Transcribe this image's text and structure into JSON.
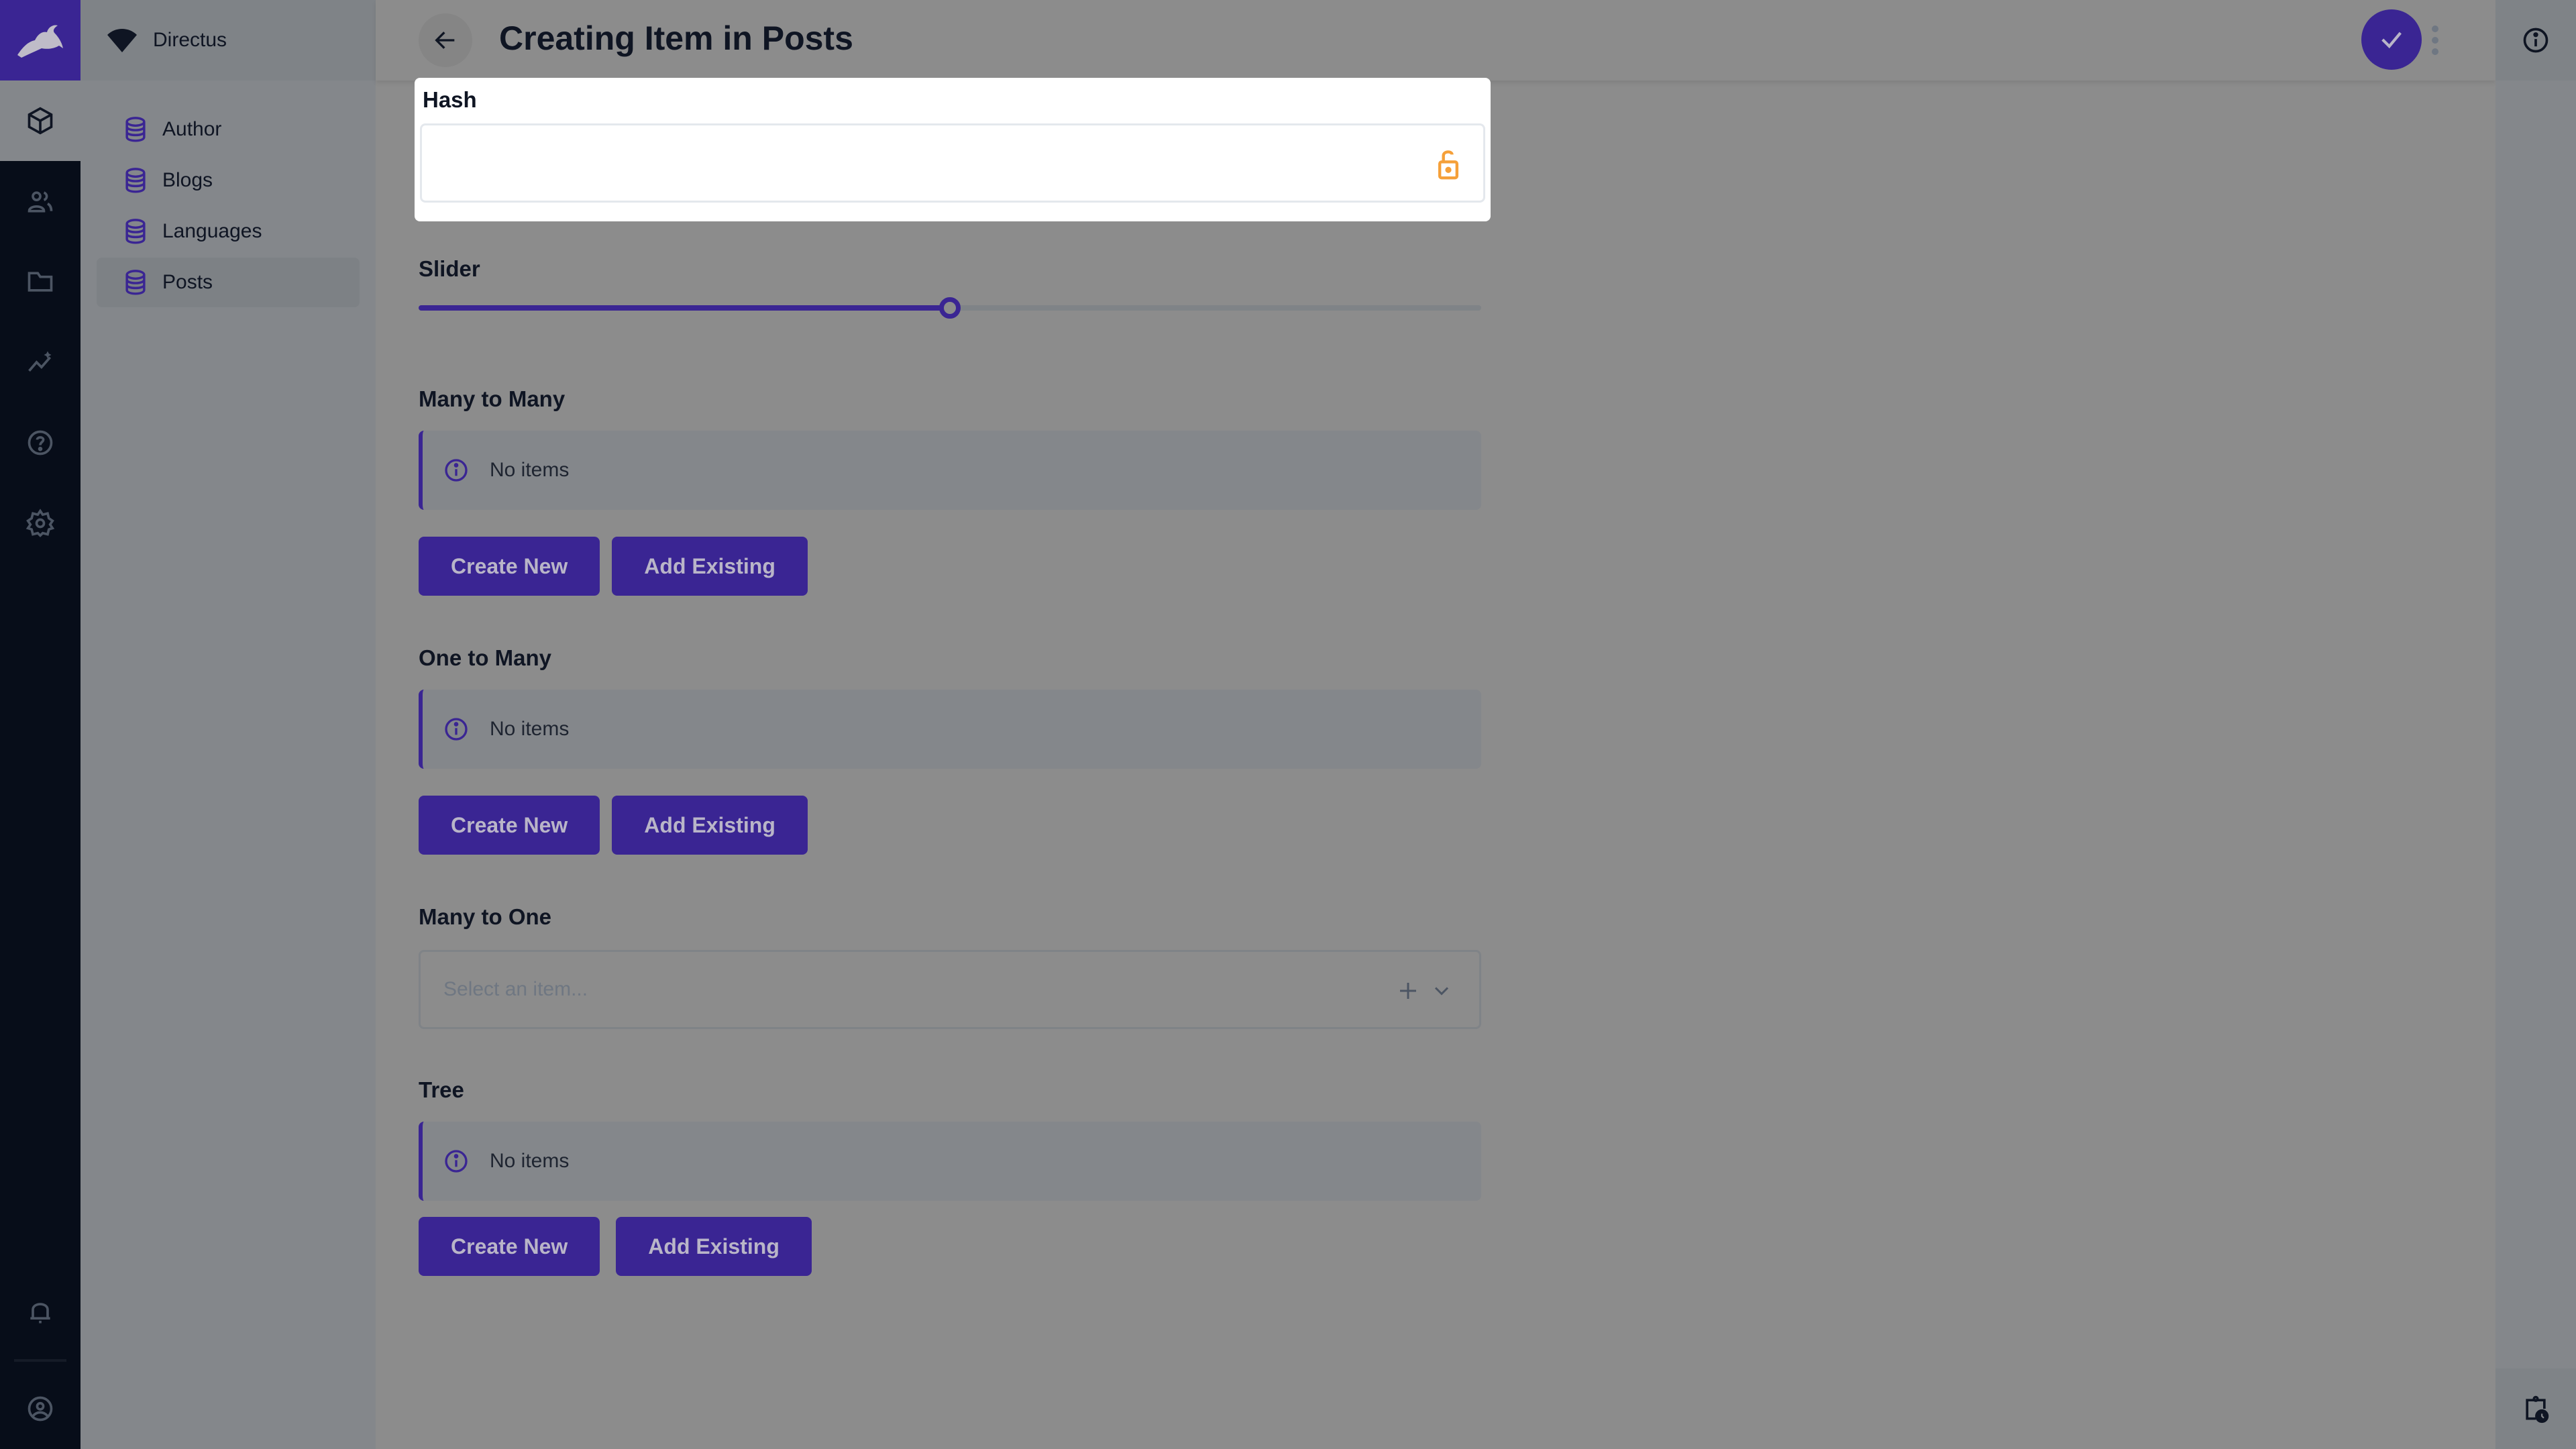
{
  "app": {
    "project_name": "Directus"
  },
  "module_bar": {
    "items": [
      {
        "name": "content",
        "icon": "cube-icon",
        "active": true
      },
      {
        "name": "user-directory",
        "icon": "users-icon",
        "active": false
      },
      {
        "name": "files",
        "icon": "folder-icon",
        "active": false
      },
      {
        "name": "insights",
        "icon": "insights-icon",
        "active": false
      },
      {
        "name": "help",
        "icon": "help-icon",
        "active": false
      },
      {
        "name": "settings",
        "icon": "gear-icon",
        "active": false
      }
    ],
    "bottom": [
      {
        "name": "notifications",
        "icon": "bell-icon"
      },
      {
        "name": "user-menu",
        "icon": "account-circle-icon"
      }
    ]
  },
  "nav": {
    "items": [
      {
        "label": "Author",
        "active": false
      },
      {
        "label": "Blogs",
        "active": false
      },
      {
        "label": "Languages",
        "active": false
      },
      {
        "label": "Posts",
        "active": true
      }
    ]
  },
  "header": {
    "title": "Creating Item in Posts"
  },
  "form": {
    "hash": {
      "label": "Hash",
      "value": "",
      "icon": "lock-open-icon"
    },
    "slider": {
      "label": "Slider",
      "value_fraction": 0.5
    },
    "many_to_many": {
      "label": "Many to Many",
      "notice": "No items",
      "create_label": "Create New",
      "add_label": "Add Existing"
    },
    "one_to_many": {
      "label": "One to Many",
      "notice": "No items",
      "create_label": "Create New",
      "add_label": "Add Existing"
    },
    "many_to_one": {
      "label": "Many to One",
      "placeholder": "Select an item..."
    },
    "tree": {
      "label": "Tree",
      "notice": "No items",
      "create_label": "Create New",
      "add_label": "Add Existing"
    }
  },
  "colors": {
    "primary": "#3a2593",
    "warning": "#f5a039",
    "module_bar": "#070d19"
  }
}
